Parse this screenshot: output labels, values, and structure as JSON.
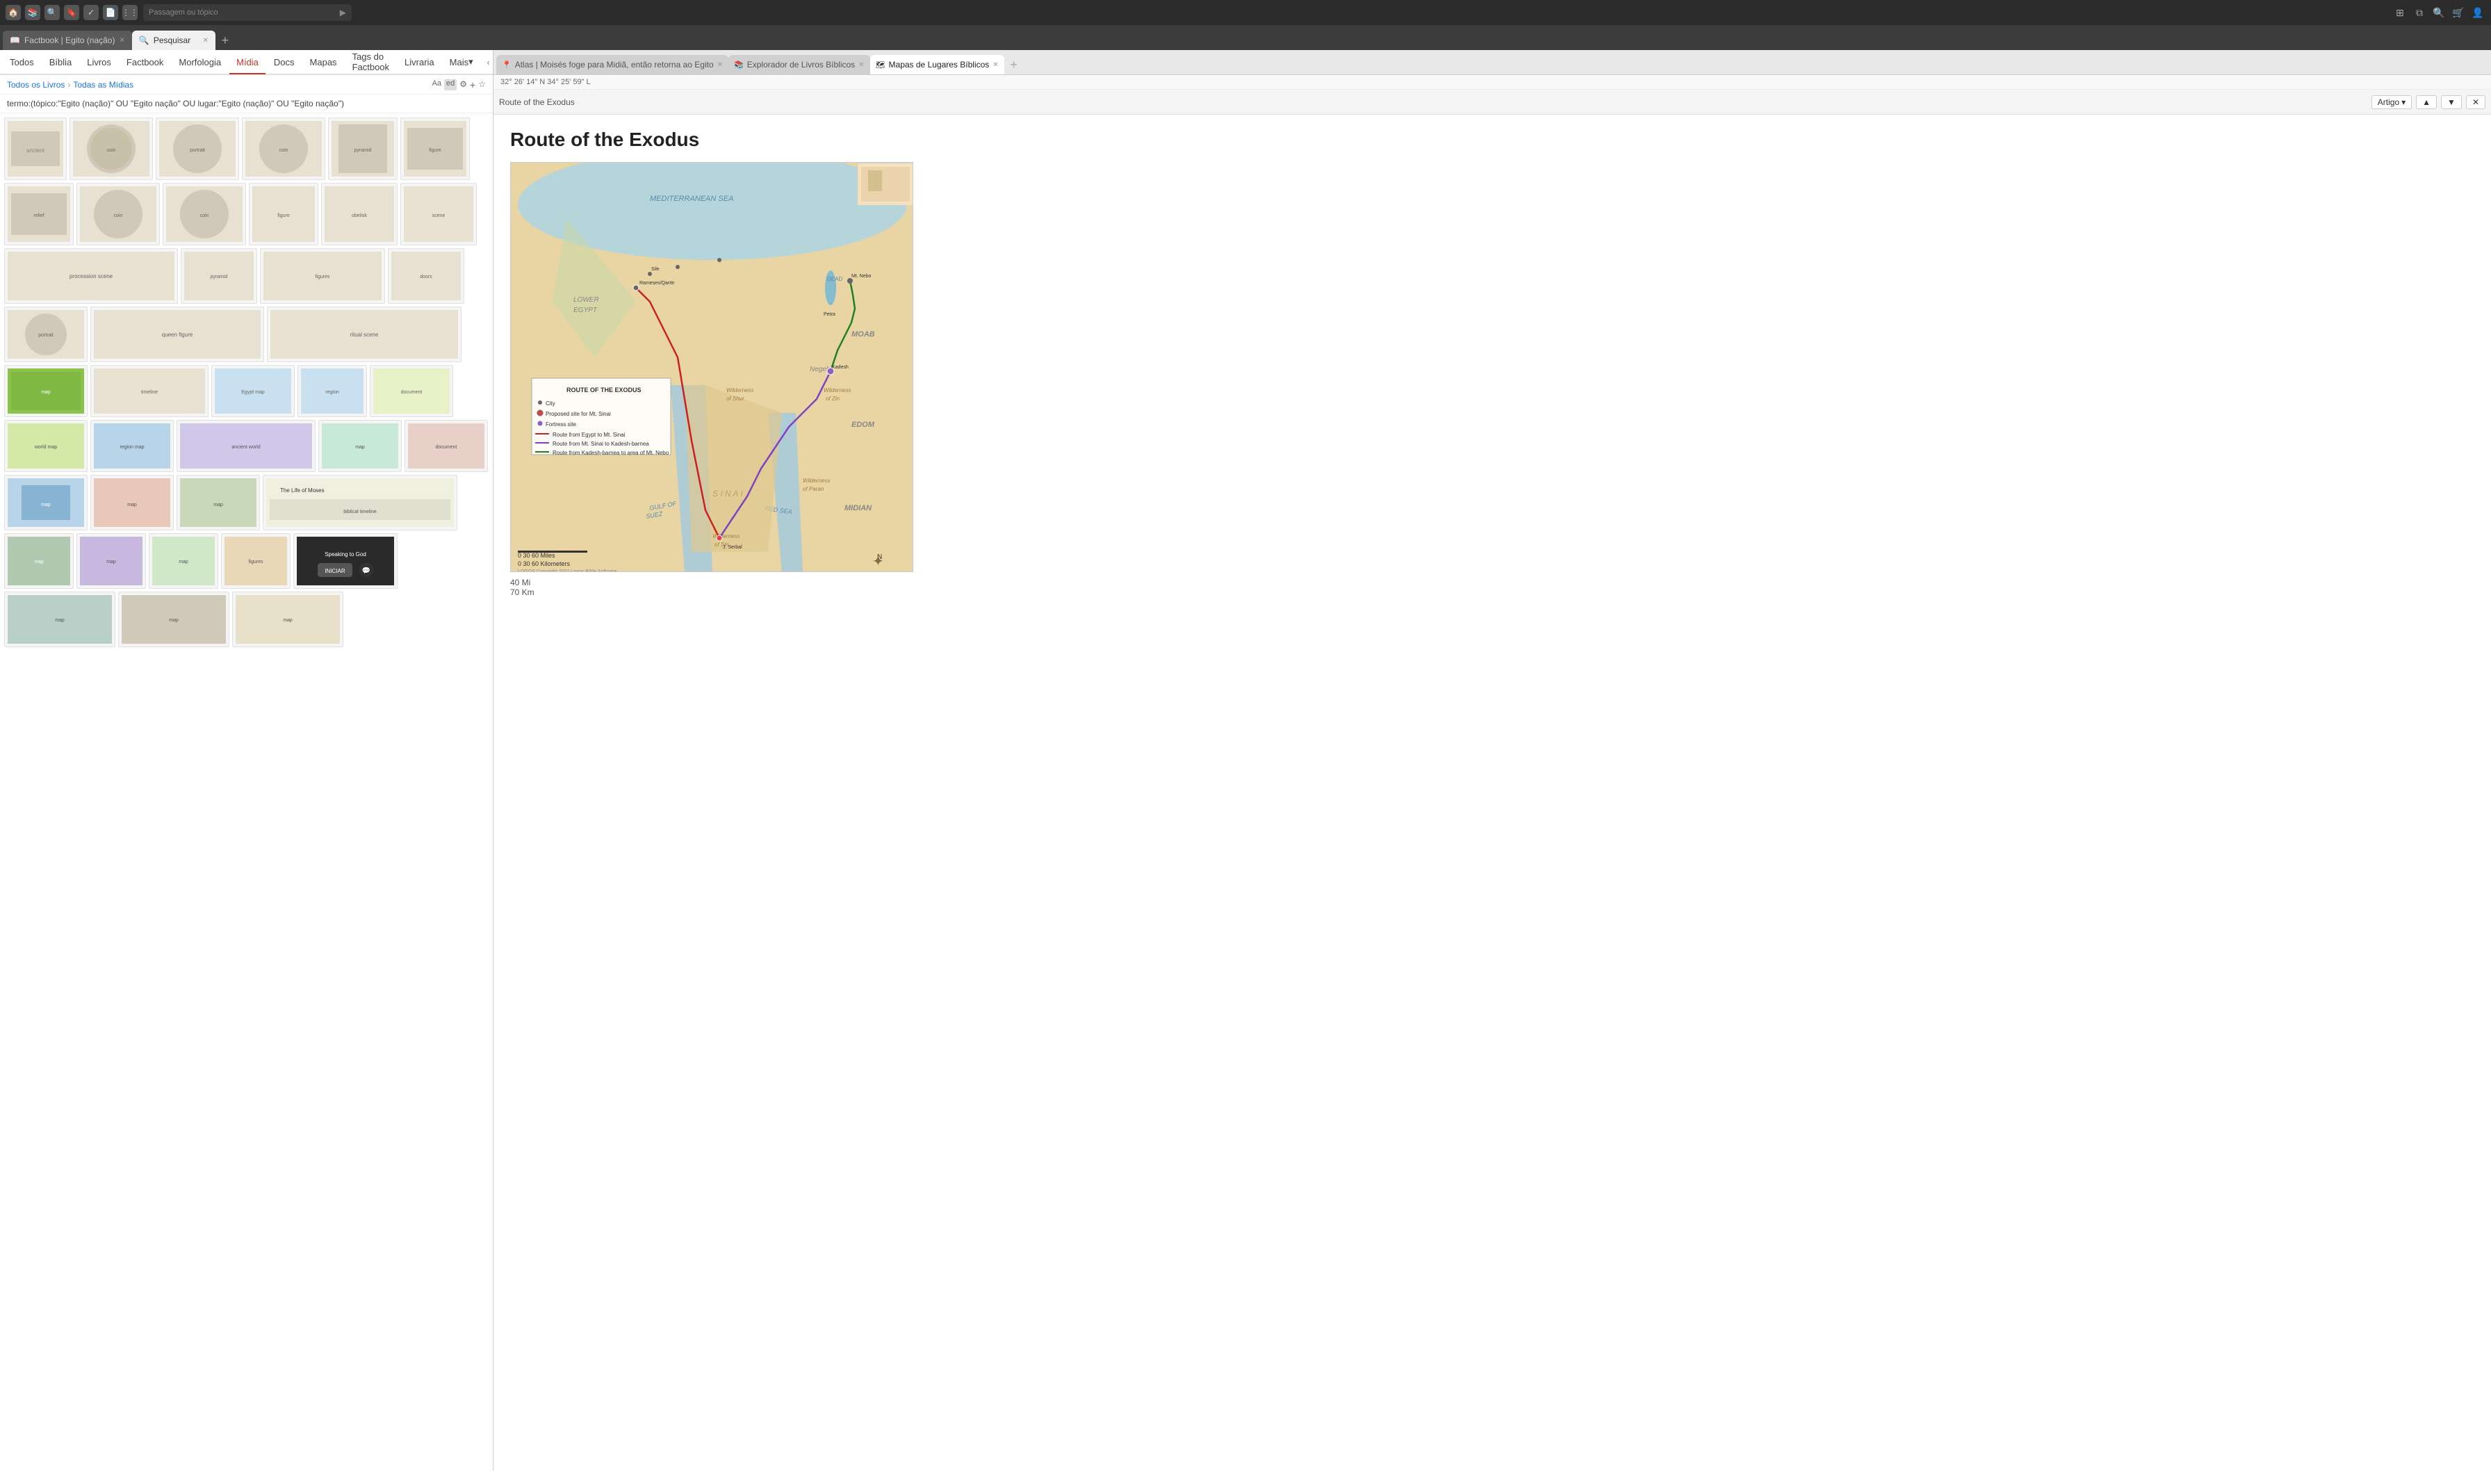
{
  "titleBar": {
    "icons": [
      "home",
      "library",
      "search",
      "bookmark",
      "check",
      "grid"
    ],
    "addressPlaceholder": "Passagem ou tópico",
    "rightIcons": [
      "layout",
      "copy",
      "search",
      "cart",
      "profile"
    ]
  },
  "tabRow1": {
    "tabs": [
      {
        "label": "Factbook | Egito (nação)",
        "active": false,
        "closeable": true
      },
      {
        "label": "Pesquisar",
        "active": true,
        "closeable": true
      }
    ],
    "addLabel": "+"
  },
  "tabRow2": {
    "tabs": [
      {
        "label": "Atlas | Moisés foge para Midiã, então retorna ao Egito",
        "active": false,
        "closeable": true
      },
      {
        "label": "Explorador de Livros Bíblicos",
        "active": false,
        "closeable": true
      },
      {
        "label": "Mapas de Lugares Bíblicos",
        "active": true,
        "closeable": true
      }
    ],
    "addLabel": "+"
  },
  "navBar": {
    "items": [
      "Todos",
      "Bíblia",
      "Livros",
      "Factbook",
      "Morfologia",
      "Mídia",
      "Docs",
      "Mapas",
      "Tags do Factbook",
      "Livraria",
      "Mais"
    ],
    "activeItem": "Mídia"
  },
  "breadcrumb": {
    "items": [
      "Todos os Livros",
      "Todas as Mídias"
    ]
  },
  "searchBar": {
    "term": "termo:(tópico:\"Egito (nação)\" OU \"Egito nação\" OU lugar:\"Egito (nação)\" OU \"Egito nação\")"
  },
  "rightPanel": {
    "coordsBar": "32° 26' 14\" N 34° 25' 59\" L",
    "titleBarLabel": "Route of the Exodus",
    "articleTypeLabel": "Artigo",
    "articleTitle": "Route of the Exodus",
    "scaleBar": {
      "line1": "40 Mi",
      "line2": "70 Km"
    }
  },
  "speakingOverlay": {
    "title": "Speaking to God",
    "buttonLabel": "INICIAR"
  },
  "mediaGrid": {
    "rows": [
      {
        "heights": [
          90,
          90,
          90,
          90,
          90,
          90
        ],
        "widths": [
          90,
          120,
          120,
          120,
          100,
          100
        ]
      },
      {
        "heights": [
          90,
          90,
          90,
          90,
          90,
          90
        ],
        "widths": [
          100,
          120,
          120,
          100,
          110,
          110
        ]
      },
      {
        "heights": [
          80,
          80,
          80,
          80
        ],
        "widths": [
          250,
          110,
          180,
          110
        ]
      },
      {
        "heights": [
          80,
          80,
          80
        ],
        "widths": [
          120,
          250,
          280
        ]
      },
      {
        "heights": [
          75,
          75,
          75,
          75,
          75
        ],
        "widths": [
          120,
          170,
          120,
          100,
          120
        ]
      },
      {
        "heights": [
          75,
          75,
          75,
          75,
          75
        ],
        "widths": [
          120,
          120,
          200,
          120,
          120
        ]
      },
      {
        "heights": [
          80,
          80,
          80,
          80
        ],
        "widths": [
          120,
          120,
          120,
          280
        ]
      },
      {
        "heights": [
          80,
          80,
          80,
          80,
          80
        ],
        "widths": [
          100,
          100,
          100,
          100,
          150
        ]
      },
      {
        "heights": [
          80,
          80,
          80
        ],
        "widths": [
          160,
          160,
          160
        ]
      }
    ]
  }
}
